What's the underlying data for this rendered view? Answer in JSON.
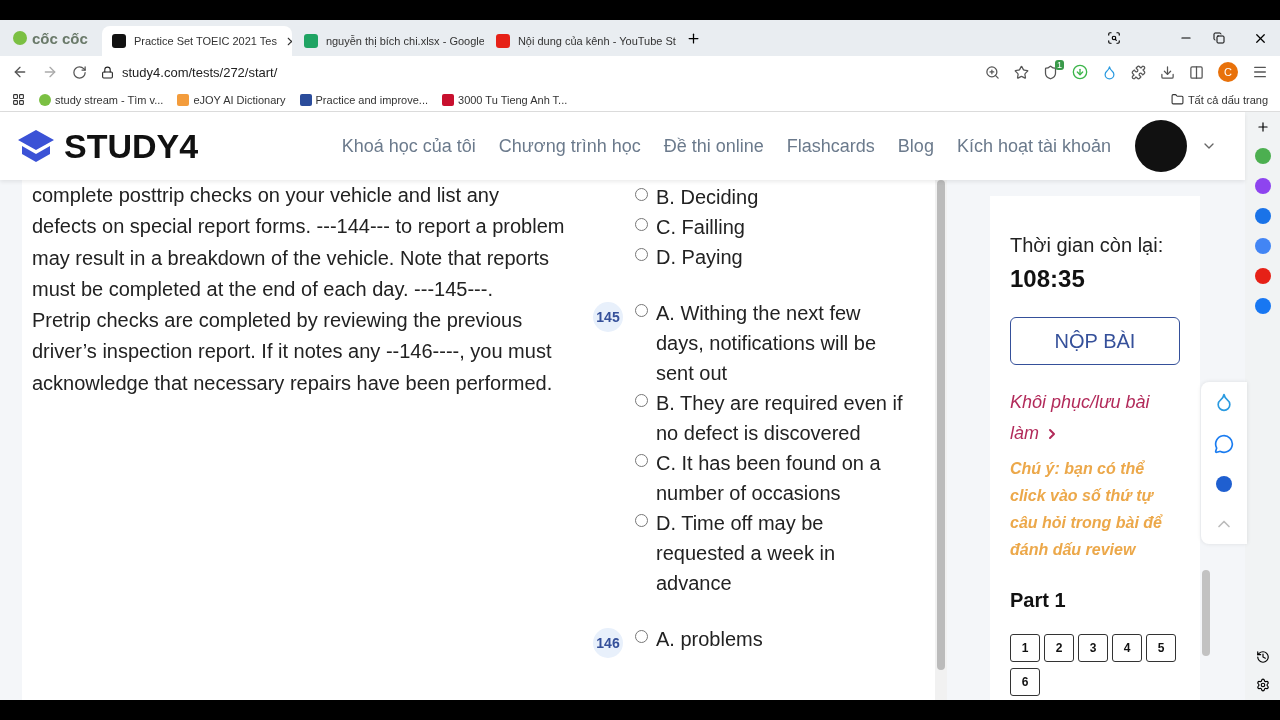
{
  "browser": {
    "brand": "cốc cốc",
    "tabs": [
      {
        "title": "Practice Set TOEIC 2021 Tes",
        "kind": "study",
        "selected": true
      },
      {
        "title": "nguyễn thị bích chi.xlsx - Google",
        "kind": "sheet",
        "selected": false
      },
      {
        "title": "Nội dung của kênh - YouTube St",
        "kind": "video",
        "selected": false
      }
    ],
    "url": "study4.com/tests/272/start/",
    "extension_badge": "1",
    "profile": "C",
    "bookmarks": [
      {
        "title": "study stream - Tìm v...",
        "kind": "leaf"
      },
      {
        "title": "eJOY AI Dictionary",
        "kind": "rainbow"
      },
      {
        "title": "Practice and improve...",
        "kind": "letter"
      },
      {
        "title": "3000 Tu Tieng Anh T...",
        "kind": "flag"
      }
    ],
    "all_bookmarks": "Tất cả dấu trang"
  },
  "site": {
    "logo": "STUDY4",
    "nav": [
      "Khoá học của tôi",
      "Chương trình học",
      "Đề thi online",
      "Flashcards",
      "Blog",
      "Kích hoạt tài khoản"
    ]
  },
  "passage": {
    "paragraphs": [
      "complete posttrip checks on your vehicle and list any defects on special report forms. ---144--- to report a problem may result in a breakdown of the vehicle. Note that reports must be completed at the end of each day. ---145---.",
      "Pretrip checks are completed by reviewing the previous driver’s inspection report. If it notes any --146----, you must acknowledge that necessary repairs have been performed."
    ]
  },
  "questions": [
    {
      "options": [
        {
          "label": "B. Deciding",
          "selected": false
        },
        {
          "label": "C. Failling",
          "selected": false
        },
        {
          "label": "D. Paying",
          "selected": false
        }
      ]
    },
    {
      "number": "145",
      "options": [
        {
          "label": "A. Withing the next few days, notifications will be sent out",
          "selected": false
        },
        {
          "label": "B. They are required even if no defect is discovered",
          "selected": false
        },
        {
          "label": "C. It has been found on a number of occasions",
          "selected": false
        },
        {
          "label": "D. Time off may be requested a week in advance",
          "selected": false
        }
      ]
    },
    {
      "number": "146",
      "options": [
        {
          "label": "A. problems",
          "selected": false
        }
      ]
    }
  ],
  "panel": {
    "timer_label": "Thời gian còn lại:",
    "timer": "108:35",
    "submit": "NỘP BÀI",
    "restore": "Khôi phục/lưu bài làm",
    "note": "Chú ý: bạn có thể click vào số thứ tự câu hỏi trong bài để đánh dấu review",
    "part": "Part 1",
    "numbers": [
      {
        "label": "1",
        "selected": false
      },
      {
        "label": "2",
        "selected": false
      },
      {
        "label": "3",
        "selected": false
      },
      {
        "label": "4",
        "selected": false
      },
      {
        "label": "5",
        "selected": false
      },
      {
        "label": "6",
        "selected": false
      }
    ]
  }
}
